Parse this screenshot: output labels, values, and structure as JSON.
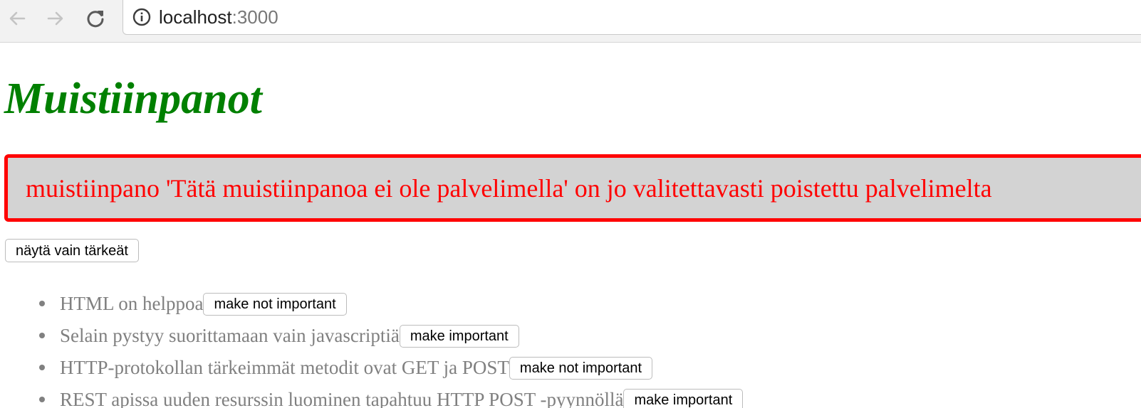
{
  "browser": {
    "url_host": "localhost",
    "url_port": ":3000",
    "back_icon": "back-arrow-icon",
    "forward_icon": "forward-arrow-icon",
    "reload_icon": "reload-icon",
    "info_icon": "info-icon"
  },
  "page": {
    "title": "Muistiinpanot",
    "title_color": "#008000",
    "error_message": "muistiinpano 'Tätä muistiinpanoa ei ole palvelimella' on jo valitettavasti poistettu palvelimelta",
    "error_color": "#ff0000",
    "error_background": "#d3d3d3",
    "show_important_label": "näytä vain tärkeät"
  },
  "notes": [
    {
      "content": "HTML on helppoa",
      "button_label": "make not important"
    },
    {
      "content": "Selain pystyy suorittamaan vain javascriptiä",
      "button_label": "make important"
    },
    {
      "content": "HTTP-protokollan tärkeimmät metodit ovat GET ja POST",
      "button_label": "make not important"
    },
    {
      "content": "REST apissa uuden resurssin luominen tapahtuu HTTP POST -pyynnöllä",
      "button_label": "make important"
    }
  ]
}
